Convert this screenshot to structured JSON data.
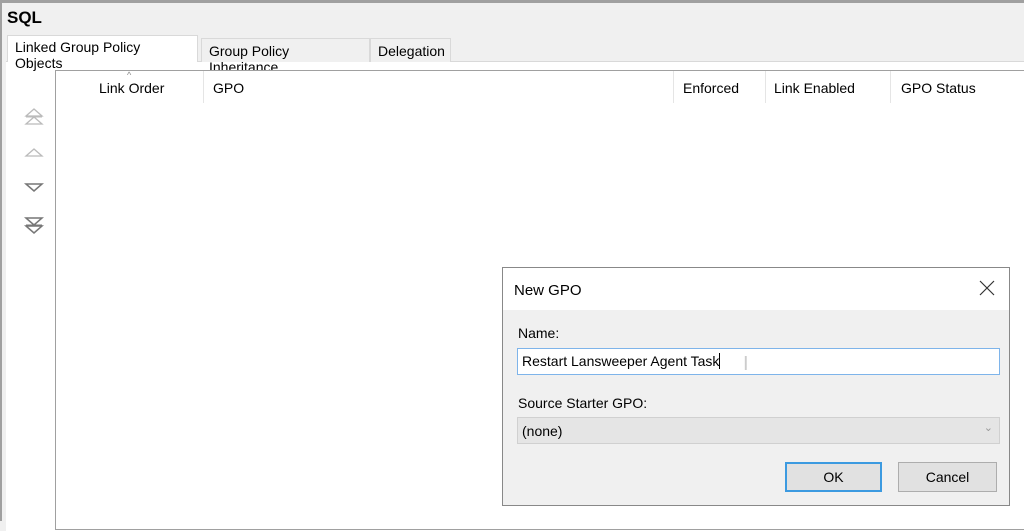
{
  "header": {
    "title": "SQL"
  },
  "tabs": [
    {
      "label": "Linked Group Policy Objects",
      "active": true
    },
    {
      "label": "Group Policy Inheritance"
    },
    {
      "label": "Delegation"
    }
  ],
  "table": {
    "columns": [
      "Link Order",
      "GPO",
      "Enforced",
      "Link Enabled",
      "GPO Status"
    ],
    "sort_column": "Link Order",
    "rows": []
  },
  "order_buttons": [
    "move-to-top-icon",
    "move-up-icon",
    "move-down-icon",
    "move-to-bottom-icon"
  ],
  "dialog": {
    "title": "New GPO",
    "name_label": "Name:",
    "name_value": "Restart Lansweeper Agent Task",
    "source_label": "Source Starter GPO:",
    "source_value": "(none)",
    "ok_label": "OK",
    "cancel_label": "Cancel",
    "accent": "#3c9ae0"
  }
}
